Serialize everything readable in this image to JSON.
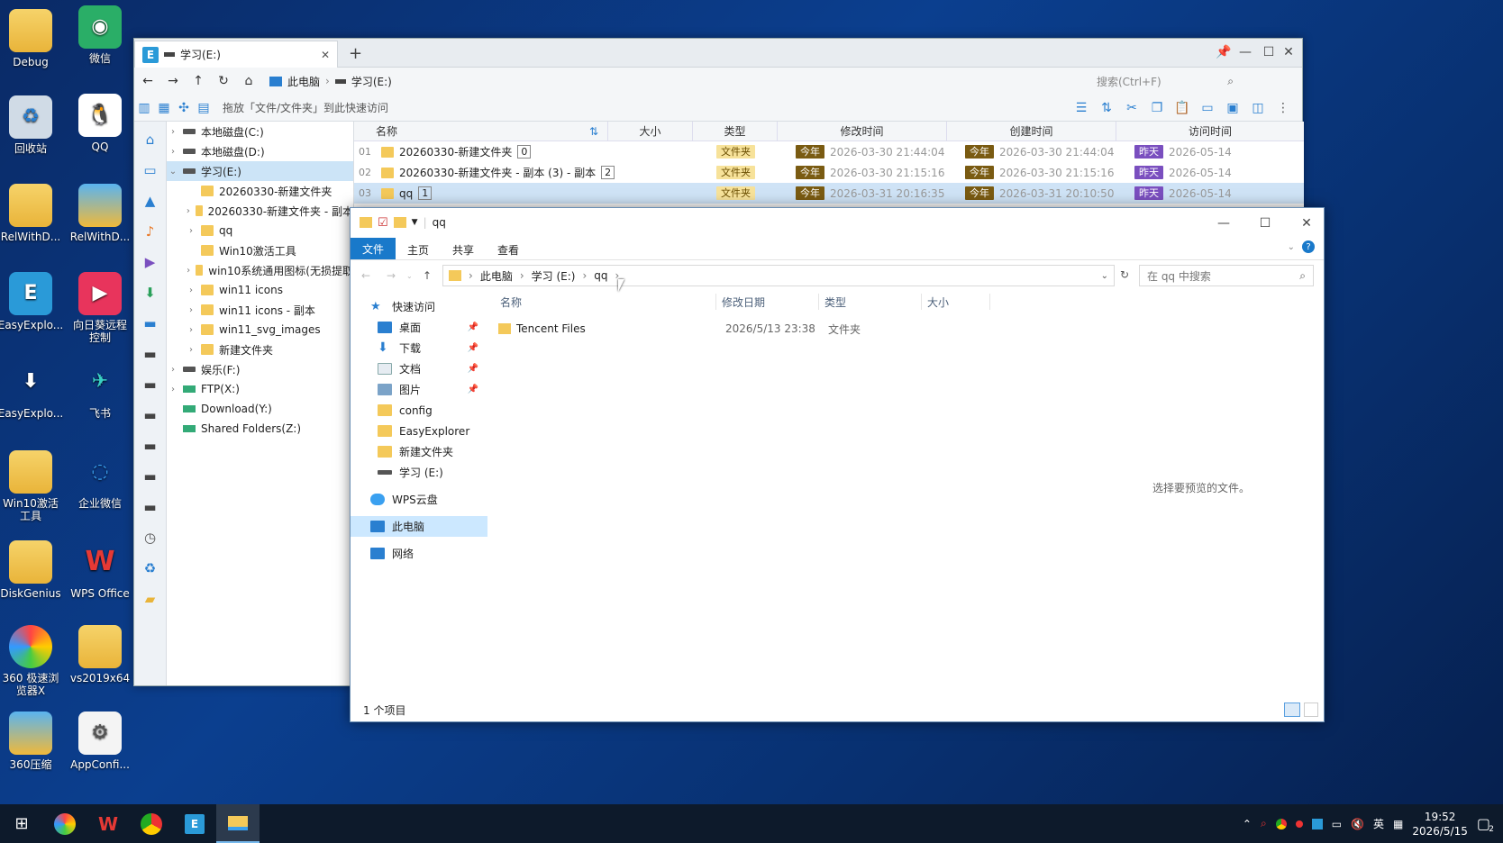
{
  "desktop": {
    "icons": [
      {
        "label": "Debug"
      },
      {
        "label": "微信"
      },
      {
        "label": "回收站"
      },
      {
        "label": "QQ"
      },
      {
        "label": "RelWithD..."
      },
      {
        "label": "RelWithD..."
      },
      {
        "label": "EasyExplo..."
      },
      {
        "label": "向日葵远程\n控制"
      },
      {
        "label": "EasyExplo..."
      },
      {
        "label": "飞书"
      },
      {
        "label": "Win10激活\n工具"
      },
      {
        "label": "企业微信"
      },
      {
        "label": "DiskGenius"
      },
      {
        "label": "WPS Office"
      },
      {
        "label": "360 极速浏\n览器X"
      },
      {
        "label": "vs2019x64"
      },
      {
        "label": "360压缩"
      },
      {
        "label": "AppConfi..."
      }
    ]
  },
  "easy_explorer": {
    "tab_title": "学习(E:)",
    "breadcrumb": [
      "此电脑",
      "学习(E:)"
    ],
    "search_placeholder": "搜索(Ctrl+F)",
    "drag_hint": "拖放「文件/文件夹」到此快速访问",
    "tree": [
      {
        "label": "本地磁盘(C:)"
      },
      {
        "label": "本地磁盘(D:)"
      },
      {
        "label": "学习(E:)"
      },
      {
        "label": "20260330-新建文件夹"
      },
      {
        "label": "20260330-新建文件夹 - 副本"
      },
      {
        "label": "qq"
      },
      {
        "label": "Win10激活工具"
      },
      {
        "label": "win10系统通用图标(无损提取"
      },
      {
        "label": "win11 icons"
      },
      {
        "label": "win11 icons - 副本"
      },
      {
        "label": "win11_svg_images"
      },
      {
        "label": "新建文件夹"
      },
      {
        "label": "娱乐(F:)"
      },
      {
        "label": "FTP(X:)"
      },
      {
        "label": "Download(Y:)"
      },
      {
        "label": "Shared Folders(Z:)"
      }
    ],
    "columns": {
      "name": "名称",
      "size": "大小",
      "type": "类型",
      "modified": "修改时间",
      "created": "创建时间",
      "accessed": "访问时间"
    },
    "rows": [
      {
        "num": "01",
        "name": "20260330-新建文件夹",
        "count": "0",
        "type": "文件夹",
        "mod_badge": "今年",
        "modified": "2026-03-30 21:44:04",
        "cre_badge": "今年",
        "created": "2026-03-30 21:44:04",
        "acc_badge": "昨天",
        "accessed": "2026-05-14"
      },
      {
        "num": "02",
        "name": "20260330-新建文件夹 - 副本 (3) - 副本",
        "count": "2",
        "type": "文件夹",
        "mod_badge": "今年",
        "modified": "2026-03-30 21:15:16",
        "cre_badge": "今年",
        "created": "2026-03-30 21:15:16",
        "acc_badge": "昨天",
        "accessed": "2026-05-14"
      },
      {
        "num": "03",
        "name": "qq",
        "count": "1",
        "type": "文件夹",
        "mod_badge": "今年",
        "modified": "2026-03-31 20:16:35",
        "cre_badge": "今年",
        "created": "2026-03-31 20:10:50",
        "acc_badge": "昨天",
        "accessed": "2026-05-14"
      }
    ]
  },
  "file_explorer": {
    "title": "qq",
    "ribbon_tabs": [
      "文件",
      "主页",
      "共享",
      "查看"
    ],
    "address": [
      "此电脑",
      "学习 (E:)",
      "qq"
    ],
    "search_placeholder": "在 qq 中搜索",
    "nav": [
      {
        "label": "快速访问"
      },
      {
        "label": "桌面"
      },
      {
        "label": "下载"
      },
      {
        "label": "文档"
      },
      {
        "label": "图片"
      },
      {
        "label": "config"
      },
      {
        "label": "EasyExplorer"
      },
      {
        "label": "新建文件夹"
      },
      {
        "label": "学习 (E:)"
      },
      {
        "label": "WPS云盘"
      },
      {
        "label": "此电脑"
      },
      {
        "label": "网络"
      }
    ],
    "columns": {
      "name": "名称",
      "modified": "修改日期",
      "type": "类型",
      "size": "大小"
    },
    "files": [
      {
        "name": "Tencent Files",
        "modified": "2026/5/13 23:38",
        "type": "文件夹",
        "size": ""
      }
    ],
    "preview_text": "选择要预览的文件。",
    "status": "1 个项目"
  },
  "taskbar": {
    "ime": "英",
    "time": "19:52",
    "date": "2026/5/15",
    "notifications": "2"
  }
}
